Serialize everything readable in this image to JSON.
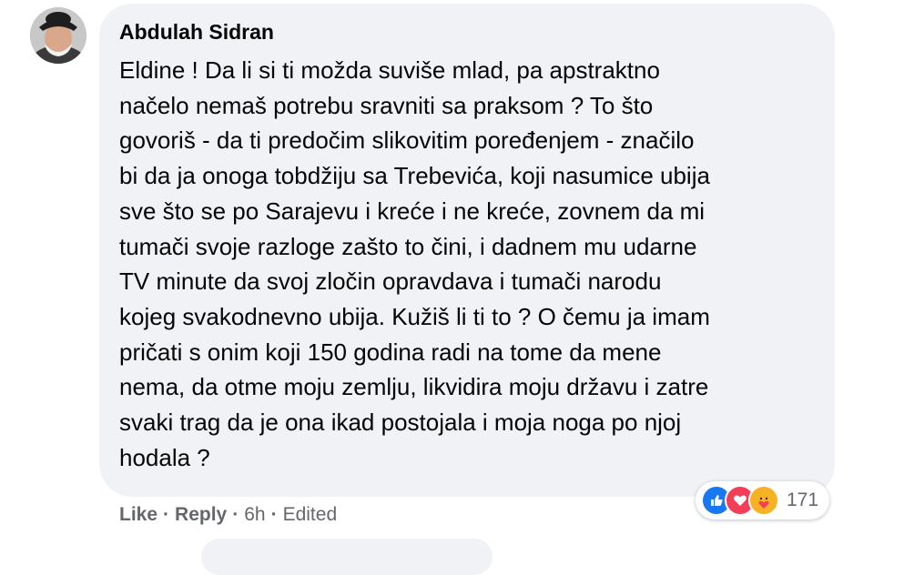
{
  "comment": {
    "author": "Abdulah Sidran",
    "lines": [
      "Eldine ! Da li si ti možda suviše mlad, pa apstraktno",
      "načelo nemaš potrebu sravniti sa praksom ? To što",
      "govoriš - da ti predočim slikovitim poređenjem - značilo",
      "bi da ja onoga tobdžiju sa Trebevića, koji nasumice ubija",
      "sve što se po Sarajevu i kreće i ne kreće, zovnem da mi",
      "tumači svoje razloge zašto to čini, i dadnem mu udarne",
      "TV minute da svoj zločin opravdava i tumači narodu",
      "kojeg svakodnevno ubija. Kužiš li ti to ? O čemu ja imam",
      "pričati s onim koji 150 godina radi na tome da mene",
      "nema, da otme moju zemlju, likvidira moju državu i zatre",
      "svaki trag da je ona ikad postojala i moja noga po njoj",
      "hodala ?"
    ]
  },
  "actions": {
    "like": "Like",
    "reply": "Reply",
    "time": "6h",
    "edited": "Edited",
    "separator": "·"
  },
  "reactions": {
    "count": "171",
    "icons": [
      "like-reaction-icon",
      "love-reaction-icon",
      "care-reaction-icon"
    ],
    "colors": {
      "like": "#1877f2",
      "love": "#f33e58",
      "care": "#f7b125"
    }
  },
  "colors": {
    "bubble": "#f0f2f5",
    "text": "#050505",
    "secondary": "#65676b"
  }
}
